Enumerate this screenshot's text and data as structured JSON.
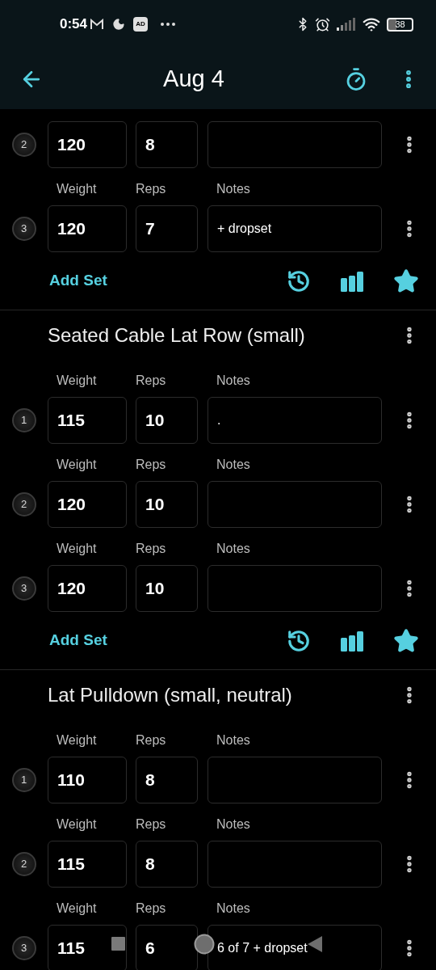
{
  "status_bar": {
    "time": "0:54",
    "ad_badge": "AD",
    "battery": "38"
  },
  "header": {
    "title": "Aug 4"
  },
  "exercises": [
    {
      "sets": [
        {
          "number": "2",
          "weight": "120",
          "reps": "8"
        },
        {
          "number": "3",
          "labels": {
            "weight": "Weight",
            "reps": "Reps",
            "notes": "Notes"
          },
          "weight": "120",
          "reps": "7",
          "notes": "+ dropset"
        }
      ],
      "add_set": "Add Set"
    },
    {
      "name": "Seated Cable Lat Row (small)",
      "sets": [
        {
          "number": "1",
          "labels": {
            "weight": "Weight",
            "reps": "Reps",
            "notes": "Notes"
          },
          "weight": "115",
          "reps": "10",
          "notes": "."
        },
        {
          "number": "2",
          "labels": {
            "weight": "Weight",
            "reps": "Reps",
            "notes": "Notes"
          },
          "weight": "120",
          "reps": "10"
        },
        {
          "number": "3",
          "labels": {
            "weight": "Weight",
            "reps": "Reps",
            "notes": "Notes"
          },
          "weight": "120",
          "reps": "10"
        }
      ],
      "add_set": "Add Set"
    },
    {
      "name": "Lat Pulldown (small, neutral)",
      "sets": [
        {
          "number": "1",
          "labels": {
            "weight": "Weight",
            "reps": "Reps",
            "notes": "Notes"
          },
          "weight": "110",
          "reps": "8"
        },
        {
          "number": "2",
          "labels": {
            "weight": "Weight",
            "reps": "Reps",
            "notes": "Notes"
          },
          "weight": "115",
          "reps": "8"
        },
        {
          "number": "3",
          "labels": {
            "weight": "Weight",
            "reps": "Reps",
            "notes": "Notes"
          },
          "weight": "115",
          "reps": "6",
          "notes": "6 of 7 + dropset"
        }
      ]
    }
  ]
}
